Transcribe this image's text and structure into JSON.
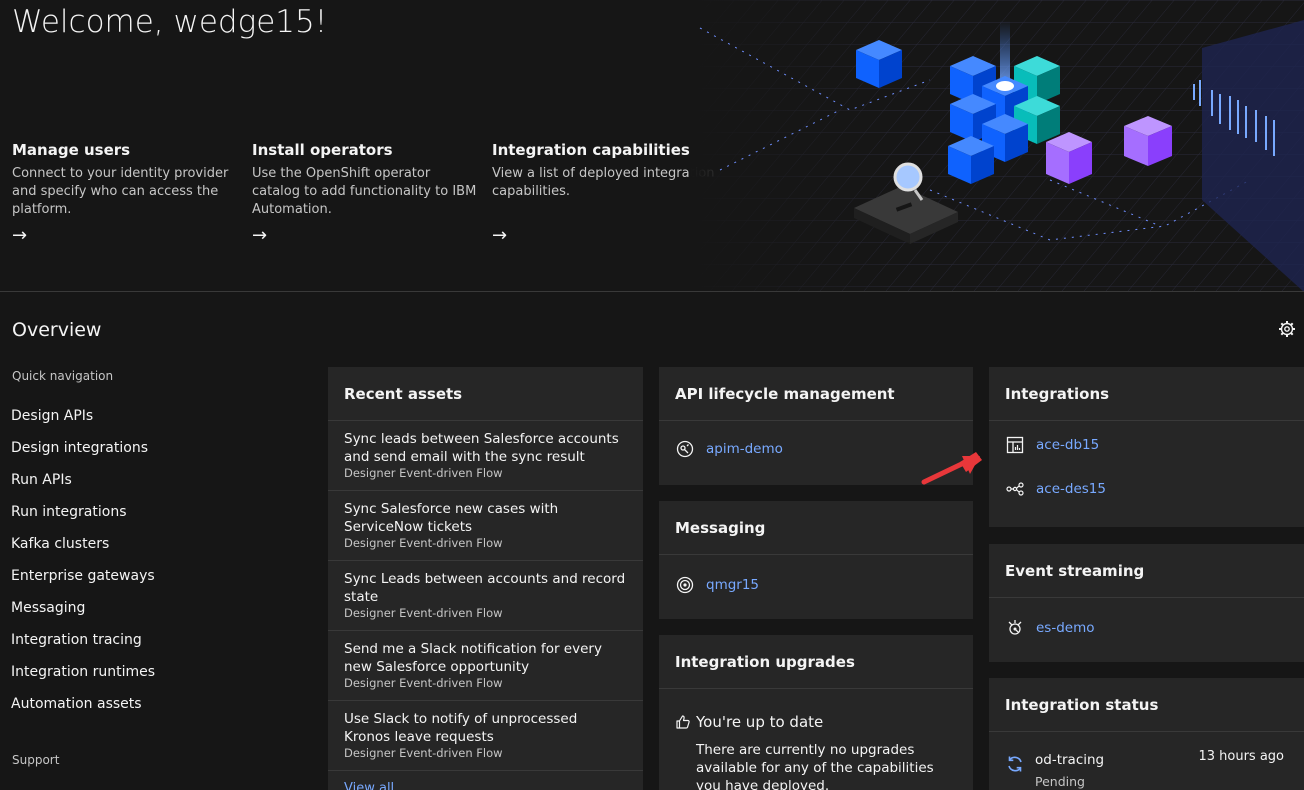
{
  "hero": {
    "title": "Welcome, wedge15!",
    "tiles": [
      {
        "title": "Manage users",
        "desc": "Connect to your identity provider and specify who can access the platform.",
        "arrow": "→"
      },
      {
        "title": "Install operators",
        "desc": "Use the OpenShift operator catalog to add functionality to IBM Automation.",
        "arrow": "→"
      },
      {
        "title": "Integration capabilities",
        "desc": "View a list of deployed integration capabilities.",
        "arrow": "→"
      }
    ]
  },
  "overview": {
    "title": "Overview",
    "settings_icon": "gear-icon"
  },
  "quick_navigation": {
    "heading": "Quick navigation",
    "items": [
      "Design APIs",
      "Design integrations",
      "Run APIs",
      "Run integrations",
      "Kafka clusters",
      "Enterprise gateways",
      "Messaging",
      "Integration tracing",
      "Integration runtimes",
      "Automation assets"
    ],
    "support": "Support"
  },
  "recent_assets": {
    "title": "Recent assets",
    "items": [
      {
        "title": "Sync leads between Salesforce accounts and send email with the sync result",
        "type": "Designer Event-driven Flow"
      },
      {
        "title": "Sync Salesforce new cases with ServiceNow tickets",
        "type": "Designer Event-driven Flow"
      },
      {
        "title": "Sync Leads between accounts and record state",
        "type": "Designer Event-driven Flow"
      },
      {
        "title": "Send me a Slack notification for every new Salesforce opportunity",
        "type": "Designer Event-driven Flow"
      },
      {
        "title": "Use Slack to notify of unprocessed Kronos leave requests",
        "type": "Designer Event-driven Flow"
      }
    ],
    "view_all": "View all"
  },
  "api_lifecycle": {
    "title": "API lifecycle management",
    "items": [
      {
        "label": "apim-demo",
        "icon": "api-connect-icon"
      }
    ]
  },
  "messaging": {
    "title": "Messaging",
    "items": [
      {
        "label": "qmgr15",
        "icon": "queue-manager-icon"
      }
    ]
  },
  "integration_upgrades": {
    "title": "Integration upgrades",
    "status": "You're up to date",
    "status_icon": "thumbs-up-icon",
    "desc": "There are currently no upgrades available for any of the capabilities you have deployed."
  },
  "integrations": {
    "title": "Integrations",
    "items": [
      {
        "label": "ace-db15",
        "icon": "dashboard-icon"
      },
      {
        "label": "ace-des15",
        "icon": "flow-designer-icon"
      }
    ]
  },
  "event_streaming": {
    "title": "Event streaming",
    "items": [
      {
        "label": "es-demo",
        "icon": "event-streams-icon"
      }
    ]
  },
  "integration_status": {
    "title": "Integration status",
    "items": [
      {
        "name": "od-tracing",
        "state": "Pending",
        "time": "13 hours ago",
        "icon": "sync-icon"
      }
    ]
  },
  "colors": {
    "background": "#161616",
    "card": "#262626",
    "link": "#78a9ff",
    "callout_arrow": "#e8373a"
  }
}
